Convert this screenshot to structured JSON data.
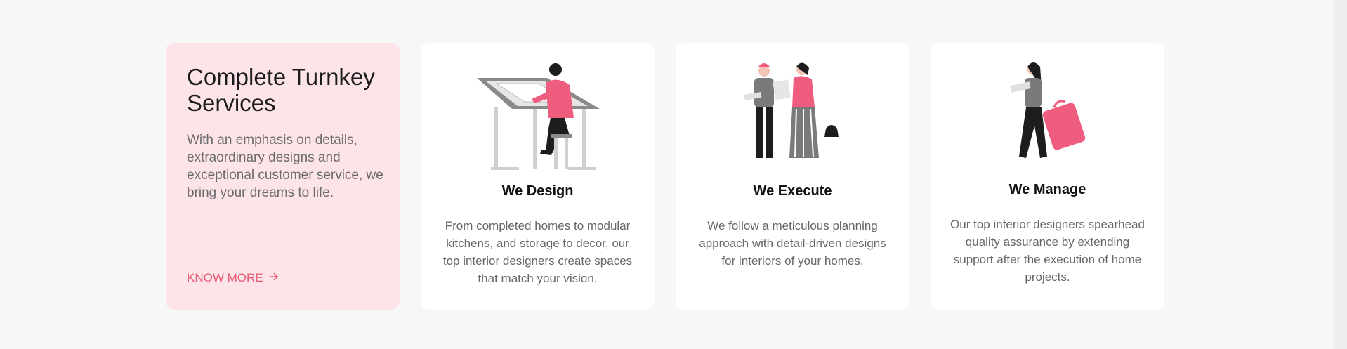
{
  "intro": {
    "title": "Complete Turnkey Services",
    "description": "With an emphasis on details, extraordinary designs and exceptional customer service, we bring your dreams to life.",
    "link_label": "KNOW MORE",
    "link_icon": "arrow-right-icon"
  },
  "services": [
    {
      "title": "We Design",
      "description": "From completed homes to modular kitchens, and storage to decor, our top interior designers create spaces that match your vision.",
      "illustration": "designer-at-drafting-table-illustration"
    },
    {
      "title": "We Execute",
      "description": "We follow a meticulous planning approach with detail-driven designs for interiors of your homes.",
      "illustration": "two-people-reviewing-plans-illustration"
    },
    {
      "title": "We Manage",
      "description": "Our top interior designers spearhead quality assurance by extending support after the execution of home projects.",
      "illustration": "woman-carrying-suitcase-illustration"
    }
  ],
  "colors": {
    "accent": "#e85a76",
    "intro_bg": "#fde4e8",
    "page_bg": "#f7f7f7"
  }
}
